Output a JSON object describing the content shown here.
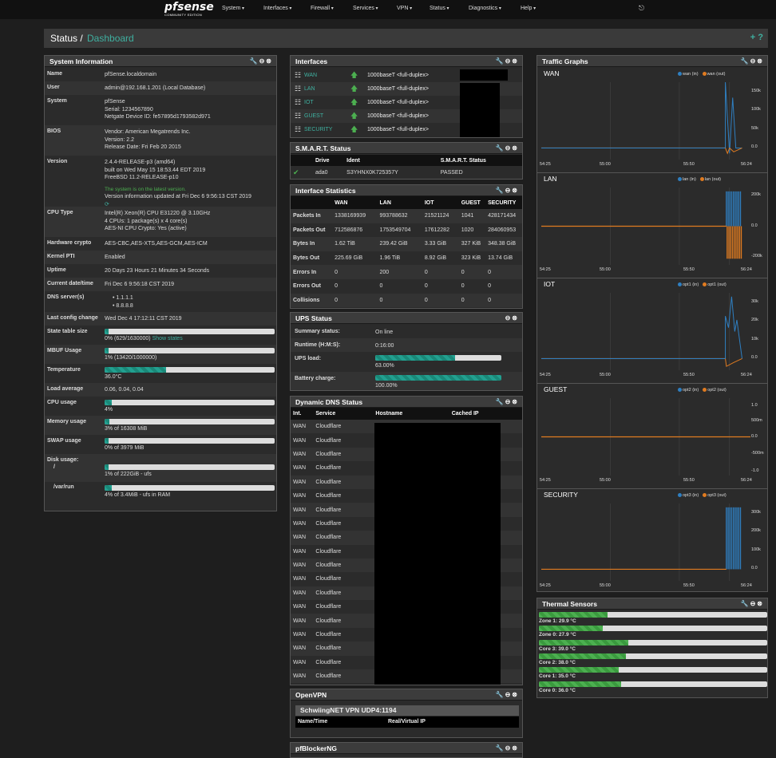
{
  "nav": {
    "logo": "sense",
    "logo_pf": "pf",
    "logo_sub": "COMMUNITY EDITION",
    "items": [
      "System",
      "Interfaces",
      "Firewall",
      "Services",
      "VPN",
      "Status",
      "Diagnostics",
      "Help"
    ],
    "logout": "⎋"
  },
  "title": {
    "crumb": "Status /",
    "page": "Dashboard",
    "actions": "+ ?"
  },
  "panel_icons": "🔧⊖⊗",
  "sysinfo": {
    "title": "System Information",
    "rows": [
      {
        "label": "Name",
        "lines": [
          "pfSense.localdomain"
        ]
      },
      {
        "label": "User",
        "lines": [
          "admin@192.168.1.201 (Local Database)"
        ]
      },
      {
        "label": "System",
        "lines": [
          "pfSense",
          "Serial: 1234567890",
          "Netgate Device ID: fe57895d1793582d971"
        ]
      },
      {
        "label": "BIOS",
        "lines": [
          "Vendor: American Megatrends Inc.",
          "Version: 2.2",
          "Release Date: Fri Feb 20 2015"
        ]
      },
      {
        "label": "Version",
        "lines": [
          "2.4.4-RELEASE-p3 (amd64)",
          "built on Wed May 15 18:53.44 EDT 2019",
          "FreeBSD 11.2-RELEASE-p10",
          "",
          "The system is on the latest version.",
          "Version information updated at Fri Dec 6 9:56:13 CST 2019"
        ]
      },
      {
        "label": "CPU Type",
        "lines": [
          "Intel(R) Xeon(R) CPU E31220 @ 3.10GHz",
          "4 CPUs: 1 package(s) x 4 core(s)",
          "AES-NI CPU Crypto: Yes (active)"
        ]
      },
      {
        "label": "Hardware crypto",
        "lines": [
          "AES-CBC,AES-XTS,AES-GCM,AES-ICM"
        ]
      },
      {
        "label": "Kernel PTI",
        "lines": [
          "Enabled"
        ]
      },
      {
        "label": "Uptime",
        "lines": [
          "20 Days 23 Hours 21 Minutes 34 Seconds"
        ]
      },
      {
        "label": "Current date/time",
        "lines": [
          "Fri Dec 6 9:56:18 CST 2019"
        ]
      },
      {
        "label": "DNS server(s)",
        "lines": [
          "•  1.1.1.1",
          "•  8.8.8.8"
        ]
      },
      {
        "label": "Last config change",
        "lines": [
          "Wed Dec 4 17:12:11 CST 2019"
        ]
      }
    ],
    "bars": [
      {
        "label": "State table size",
        "text": "0% (629/1630000)",
        "link": "Show states",
        "pct": 0.04
      },
      {
        "label": "MBUF Usage",
        "text": "1% (13420/1000000)",
        "pct": 1.3
      },
      {
        "label": "Temperature",
        "text": "36.0°C",
        "pct": 36
      },
      {
        "label": "Load average",
        "text": "0.06, 0.04, 0.04",
        "pct": null
      },
      {
        "label": "CPU usage",
        "text": "4%",
        "pct": 4
      },
      {
        "label": "Memory usage",
        "text": "3% of 16308 MiB",
        "pct": 3
      },
      {
        "label": "SWAP usage",
        "text": "0% of 3979 MiB",
        "pct": 0
      },
      {
        "label": "Disk usage:",
        "sub": "/",
        "text": "1% of 222GiB - ufs",
        "pct": 1
      },
      {
        "label": "",
        "sub": "/var/run",
        "text": "4% of 3.4MiB - ufs in RAM",
        "pct": 4
      }
    ]
  },
  "interfaces": {
    "title": "Interfaces",
    "rows": [
      {
        "name": "WAN",
        "media": "1000baseT <full-duplex>"
      },
      {
        "name": "LAN",
        "media": "1000baseT <full-duplex>"
      },
      {
        "name": "IOT",
        "media": "1000baseT <full-duplex>"
      },
      {
        "name": "GUEST",
        "media": "1000baseT <full-duplex>"
      },
      {
        "name": "SECURITY",
        "media": "1000baseT <full-duplex>"
      }
    ]
  },
  "smart": {
    "title": "S.M.A.R.T. Status",
    "headers": [
      "Drive",
      "Ident",
      "S.M.A.R.T. Status"
    ],
    "row": [
      "ada0",
      "S3YHNX0K725357Y",
      "PASSED"
    ]
  },
  "ifstats": {
    "title": "Interface Statistics",
    "headers": [
      "",
      "WAN",
      "LAN",
      "IOT",
      "GUEST",
      "SECURITY"
    ],
    "rows": [
      [
        "Packets In",
        "1338169939",
        "993788632",
        "21521124",
        "1041",
        "428171434"
      ],
      [
        "Packets Out",
        "712586876",
        "1753549704",
        "17612282",
        "1020",
        "284060953"
      ],
      [
        "Bytes In",
        "1.62 TiB",
        "239.42 GiB",
        "3.33 GiB",
        "327 KiB",
        "348.38 GiB"
      ],
      [
        "Bytes Out",
        "225.69 GiB",
        "1.96 TiB",
        "8.92 GiB",
        "323 KiB",
        "13.74 GiB"
      ],
      [
        "Errors In",
        "0",
        "200",
        "0",
        "0",
        "0"
      ],
      [
        "Errors Out",
        "0",
        "0",
        "0",
        "0",
        "0"
      ],
      [
        "Collisions",
        "0",
        "0",
        "0",
        "0",
        "0"
      ]
    ]
  },
  "ups": {
    "title": "UPS Status",
    "rows": [
      {
        "label": "Summary status:",
        "value": "On line"
      },
      {
        "label": "Runtime (H:M:S):",
        "value": "0:16:00"
      },
      {
        "label": "UPS load:",
        "value": "63.00%",
        "pct": 63
      },
      {
        "label": "Battery charge:",
        "value": "100.00%",
        "pct": 100
      }
    ]
  },
  "ddns": {
    "title": "Dynamic DNS Status",
    "headers": [
      "Int.",
      "Service",
      "Hostname",
      "Cached IP"
    ],
    "int": "WAN",
    "service": "Cloudflare",
    "count": 19
  },
  "openvpn": {
    "title": "OpenVPN",
    "server": "SchwiingNET VPN UDP4:1194",
    "headers": [
      "Name/Time",
      "Real/Virtual IP"
    ]
  },
  "pfblocker": {
    "title": "pfBlockerNG"
  },
  "traffic": {
    "title": "Traffic Graphs",
    "xticks": [
      "54:25",
      "55:00",
      "55:50",
      "56:24"
    ],
    "graphs": [
      {
        "name": "WAN",
        "in": "wan (in)",
        "out": "wan (out)",
        "yticks": [
          "150k",
          "100k",
          "50k",
          "0.0"
        ]
      },
      {
        "name": "LAN",
        "in": "lan (in)",
        "out": "lan (out)",
        "yticks": [
          "200k",
          "0.0",
          "-200k"
        ]
      },
      {
        "name": "IOT",
        "in": "opt1 (in)",
        "out": "opt1 (out)",
        "yticks": [
          "30k",
          "20k",
          "10k",
          "0.0"
        ]
      },
      {
        "name": "GUEST",
        "in": "opt2 (in)",
        "out": "opt2 (out)",
        "yticks": [
          "1.0",
          "500m",
          "0.0",
          "-500m",
          "-1.0"
        ]
      },
      {
        "name": "SECURITY",
        "in": "opt3 (in)",
        "out": "opt3 (out)",
        "yticks": [
          "300k",
          "200k",
          "100k",
          "0.0"
        ]
      }
    ]
  },
  "thermal": {
    "title": "Thermal Sensors",
    "sensors": [
      {
        "label": "Zone 1: 29.9 °C",
        "pct": 29.9
      },
      {
        "label": "Zone 0: 27.9 °C",
        "pct": 27.9
      },
      {
        "label": "Core 3: 39.0 °C",
        "pct": 39
      },
      {
        "label": "Core 2: 38.0 °C",
        "pct": 38
      },
      {
        "label": "Core 1: 35.0 °C",
        "pct": 35
      },
      {
        "label": "Core 0: 36.0 °C",
        "pct": 36
      }
    ]
  },
  "colors": {
    "accent": "#3fb0a0",
    "in": "#2f7fc1",
    "out": "#e07b20"
  }
}
